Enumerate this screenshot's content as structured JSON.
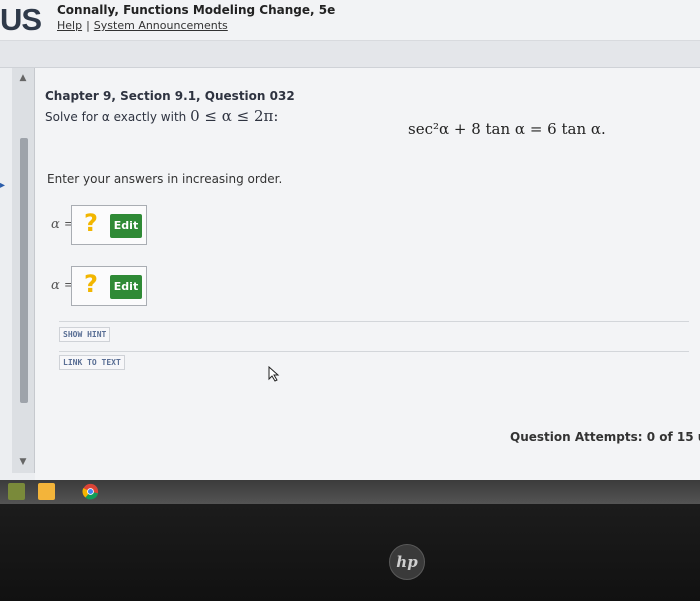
{
  "header": {
    "logo_text": "US",
    "book_title": "Connally, Functions Modeling Change, 5e",
    "help_link": "Help",
    "separator": "|",
    "announcements_link": "System Announcements"
  },
  "question": {
    "title": "Chapter 9, Section 9.1, Question 032",
    "instruction_text": "Solve for α exactly with",
    "instruction_math": "0 ≤ α ≤ 2π:",
    "equation": "sec²α + 8 tan  α = 6 tan α.",
    "order_note": "Enter your answers in increasing order."
  },
  "answers": [
    {
      "label": "α =",
      "placeholder_symbol": "?",
      "edit_label": "Edit"
    },
    {
      "label": "α =",
      "placeholder_symbol": "?",
      "edit_label": "Edit"
    }
  ],
  "buttons": {
    "show_hint": "SHOW HINT",
    "link_to_text": "LINK TO TEXT"
  },
  "attempts_text": "Question Attempts: 0 of 15 u",
  "taskbar": {
    "icons": [
      "app-icon",
      "chrome-icon"
    ]
  },
  "bezel": {
    "brand": "hp"
  },
  "colors": {
    "edit_button": "#2f8a36",
    "answer_placeholder": "#f2b600",
    "link_button_text": "#5a6f95"
  }
}
